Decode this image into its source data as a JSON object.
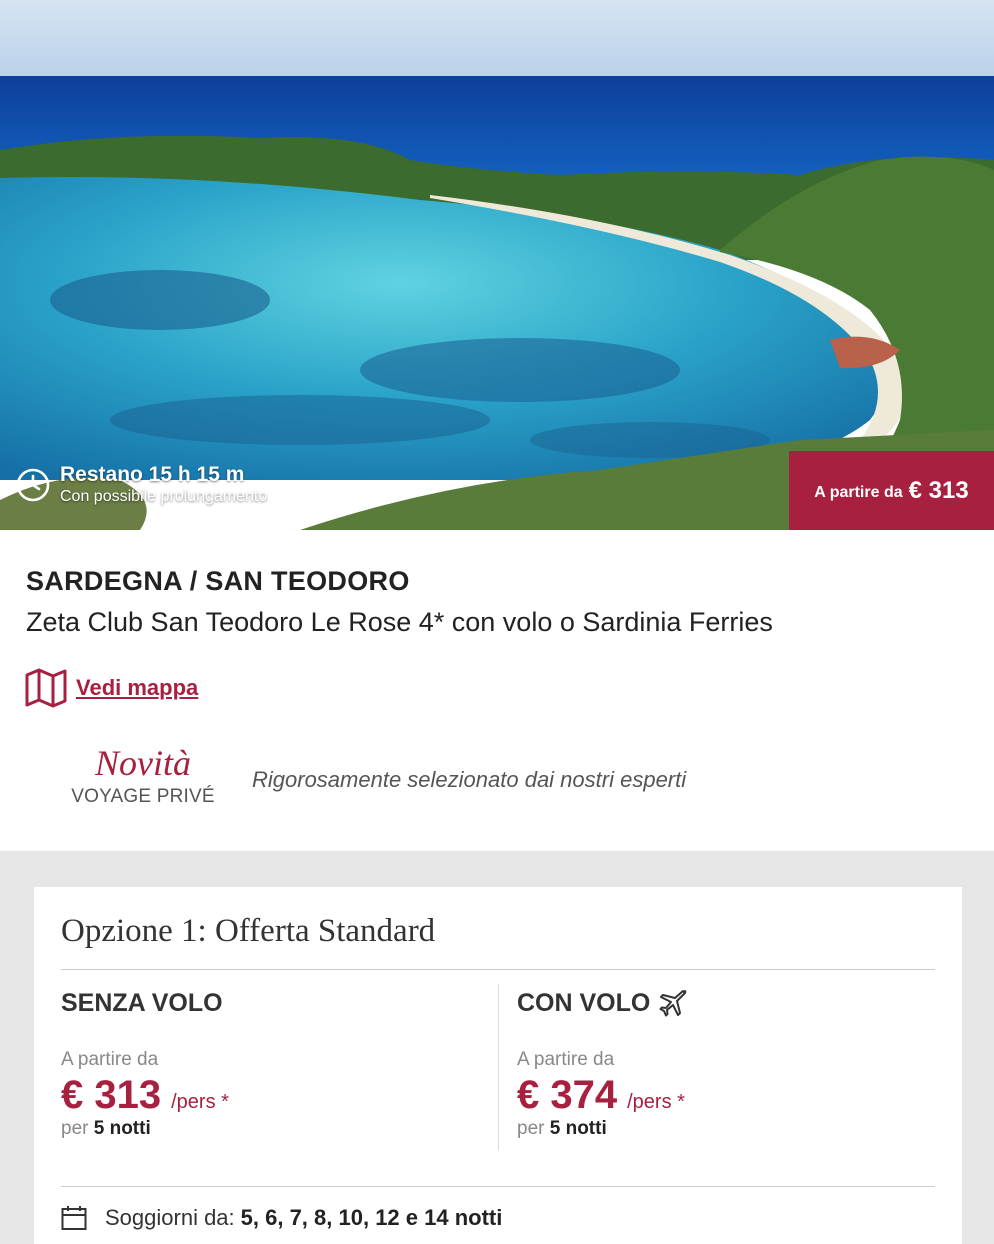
{
  "hero": {
    "timer_main": "Restano 15 h 15 m",
    "timer_sub": "Con possibile prolungamento",
    "price_label": "A partire da",
    "price_amount": "€ 313"
  },
  "destination": {
    "region": "SARDEGNA / SAN TEODORO",
    "hotel_name": "Zeta Club San Teodoro Le Rose 4* con volo o Sardinia Ferries",
    "map_link": "Vedi mappa"
  },
  "badge": {
    "title": "Novità",
    "subtitle": "VOYAGE PRIVÉ",
    "tagline": "Rigorosamente selezionato dai nostri esperti"
  },
  "offer": {
    "title": "Opzione 1: Offerta Standard",
    "without_flight": {
      "heading": "SENZA VOLO",
      "from_label": "A partire da",
      "price": "€ 313",
      "unit": "/pers *",
      "nights_prefix": "per",
      "nights": "5 notti"
    },
    "with_flight": {
      "heading": "CON VOLO",
      "from_label": "A partire da",
      "price": "€ 374",
      "unit": "/pers *",
      "nights_prefix": "per",
      "nights": "5 notti"
    },
    "stay_label": "Soggiorni da:",
    "stay_values": "5, 6, 7, 8, 10, 12 e 14 notti"
  },
  "colors": {
    "accent": "#a8203f",
    "band": "#e6e6e6"
  },
  "icons": [
    "clock-icon",
    "map-icon",
    "plane-icon",
    "calendar-icon"
  ]
}
